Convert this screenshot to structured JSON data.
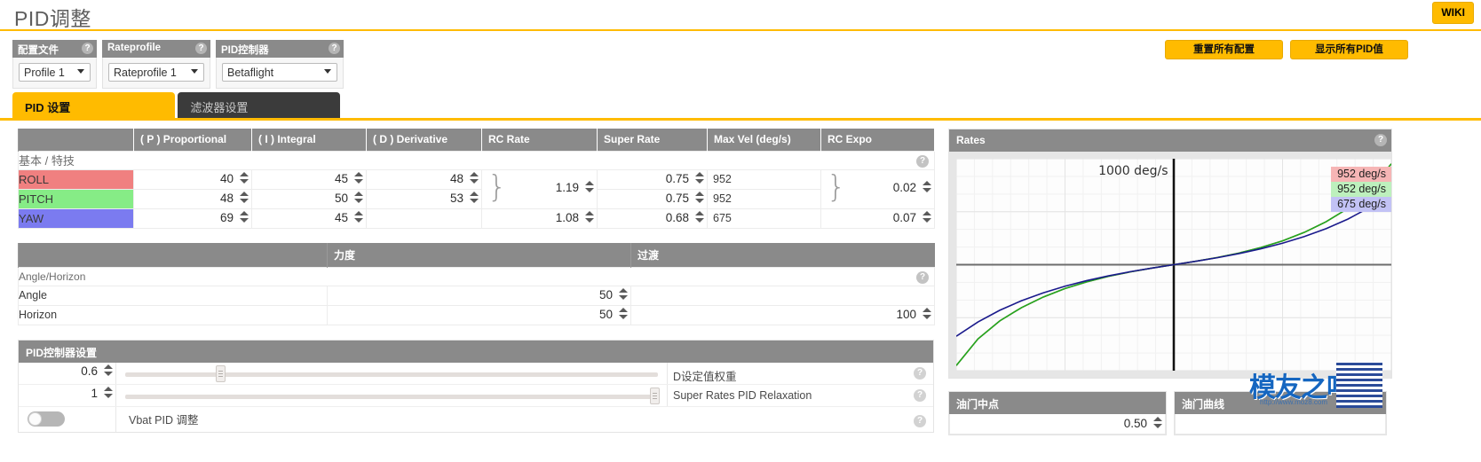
{
  "header": {
    "title": "PID调整",
    "wiki_label": "WIKI",
    "accent_color": "#ffbb00"
  },
  "top_controls": {
    "groups": [
      {
        "name": "profile",
        "label": "配置文件",
        "value": "Profile 1",
        "help": "?"
      },
      {
        "name": "rateprofile",
        "label": "Rateprofile",
        "value": "Rateprofile 1",
        "help": "?"
      },
      {
        "name": "controller",
        "label": "PID控制器",
        "value": "Betaflight",
        "help": "?"
      }
    ],
    "buttons": [
      {
        "name": "reset-all",
        "label": "重置所有配置"
      },
      {
        "name": "show-all-pids",
        "label": "显示所有PID值"
      }
    ]
  },
  "tabs": [
    {
      "label": "PID 设置",
      "active": true
    },
    {
      "label": "滤波器设置",
      "active": false
    }
  ],
  "pid_table": {
    "headers": [
      "",
      "( P ) Proportional",
      "( I ) Integral",
      "( D ) Derivative",
      "RC Rate",
      "Super Rate",
      "Max Vel (deg/s)",
      "RC Expo"
    ],
    "group_label": "基本 / 特技",
    "rows": [
      {
        "axis": "ROLL",
        "color": "#f08080",
        "p": "40",
        "i": "45",
        "d": "48",
        "rc_rate": "1.19",
        "super_rate": "0.75",
        "max_vel": "952",
        "rc_expo": "0.02"
      },
      {
        "axis": "PITCH",
        "color": "#86ec86",
        "p": "48",
        "i": "50",
        "d": "53",
        "rc_rate": "",
        "super_rate": "0.75",
        "max_vel": "952",
        "rc_expo": ""
      },
      {
        "axis": "YAW",
        "color": "#7b7bf0",
        "p": "69",
        "i": "45",
        "d": "",
        "rc_rate": "1.08",
        "super_rate": "0.68",
        "max_vel": "675",
        "rc_expo": "0.07"
      }
    ]
  },
  "angle_table": {
    "headers": [
      "",
      "力度",
      "过渡"
    ],
    "group_label": "Angle/Horizon",
    "rows": [
      {
        "name": "Angle",
        "strength": "50",
        "transition": ""
      },
      {
        "name": "Horizon",
        "strength": "50",
        "transition": "100"
      }
    ]
  },
  "pid_settings": {
    "title": "PID控制器设置",
    "sliders": [
      {
        "value": "0.6",
        "label": "D设定值权重",
        "pct": 18
      },
      {
        "value": "1",
        "label": "Super Rates PID Relaxation",
        "pct": 100
      }
    ],
    "toggle": {
      "label": "Vbat PID 调整",
      "on": false
    }
  },
  "rates_panel": {
    "title": "Rates",
    "axis_note": "1000 deg/s",
    "badges": [
      {
        "text": "952 deg/s",
        "color": "#f6b5b5"
      },
      {
        "text": "952 deg/s",
        "color": "#bdf0bd"
      },
      {
        "text": "675 deg/s",
        "color": "#c2c2f5"
      }
    ]
  },
  "chart_data": {
    "type": "line",
    "title": "Rates",
    "xlabel": "",
    "ylabel": "deg/s",
    "annotation": "1000 deg/s",
    "xlim": [
      -1,
      1
    ],
    "ylim": [
      -1000,
      1000
    ],
    "grid": true,
    "legend": [
      "952 deg/s",
      "952 deg/s",
      "675 deg/s"
    ],
    "x": [
      -1,
      -0.9,
      -0.8,
      -0.7,
      -0.6,
      -0.5,
      -0.4,
      -0.3,
      -0.2,
      -0.1,
      0,
      0.1,
      0.2,
      0.3,
      0.4,
      0.5,
      0.6,
      0.7,
      0.8,
      0.9,
      1
    ],
    "series": [
      {
        "name": "ROLL",
        "color": "#d04a4a",
        "max": 952,
        "values": [
          -952,
          -700,
          -530,
          -405,
          -305,
          -225,
          -162,
          -110,
          -68,
          -32,
          0,
          32,
          68,
          110,
          162,
          225,
          305,
          405,
          530,
          700,
          952
        ]
      },
      {
        "name": "PITCH",
        "color": "#1faa1f",
        "max": 952,
        "values": [
          -952,
          -700,
          -530,
          -405,
          -305,
          -225,
          -162,
          -110,
          -68,
          -32,
          0,
          32,
          68,
          110,
          162,
          225,
          305,
          405,
          530,
          700,
          952
        ]
      },
      {
        "name": "YAW",
        "color": "#1a1a8c",
        "max": 675,
        "values": [
          -675,
          -540,
          -430,
          -340,
          -266,
          -203,
          -150,
          -105,
          -66,
          -32,
          0,
          32,
          66,
          105,
          150,
          203,
          266,
          340,
          430,
          540,
          675
        ]
      }
    ]
  },
  "throttle": {
    "mid_title": "油门中点",
    "mid_value": "0.50",
    "curve_title": "油门曲线"
  },
  "watermark": {
    "text": "模友之吧",
    "url": "http://www.moz8.com"
  }
}
